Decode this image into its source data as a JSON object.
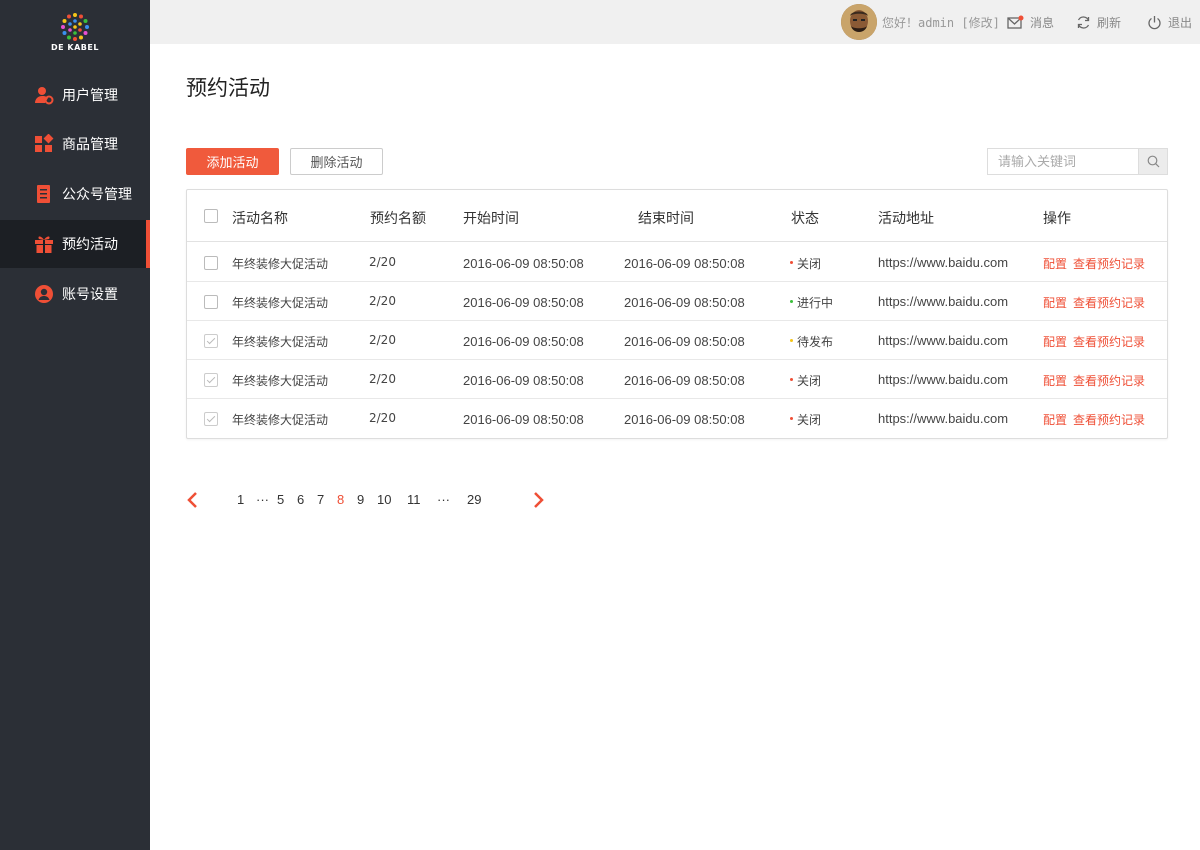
{
  "app": {
    "logo_text": "DE KABEL"
  },
  "sidebar": {
    "items": [
      {
        "label": "用户管理",
        "icon": "user-settings-icon",
        "active": false
      },
      {
        "label": "商品管理",
        "icon": "apps-icon",
        "active": false
      },
      {
        "label": "公众号管理",
        "icon": "document-icon",
        "active": false
      },
      {
        "label": "预约活动",
        "icon": "gift-icon",
        "active": true
      },
      {
        "label": "账号设置",
        "icon": "account-icon",
        "active": false
      }
    ]
  },
  "topbar": {
    "greeting": "您好！admin [修改]",
    "messages_label": "消息",
    "refresh_label": "刷新",
    "logout_label": "退出"
  },
  "page": {
    "title": "预约活动",
    "add_button": "添加活动",
    "delete_button": "删除活动",
    "search_placeholder": "请输入关键词"
  },
  "table": {
    "headers": [
      "活动名称",
      "预约名额",
      "开始时间",
      "结束时间",
      "状态",
      "活动地址",
      "操作"
    ],
    "rows": [
      {
        "checked": false,
        "name": "年终装修大促活动",
        "quota": "2/20",
        "start": "2016-06-09  08:50:08",
        "end": "2016-06-09  08:50:08",
        "status": "关闭",
        "status_color": "#ef4f36",
        "url": "https://www.baidu.com",
        "op1": "配置",
        "op2": "查看预约记录"
      },
      {
        "checked": false,
        "name": "年终装修大促活动",
        "quota": "2/20",
        "start": "2016-06-09  08:50:08",
        "end": "2016-06-09  08:50:08",
        "status": "进行中",
        "status_color": "#3bbf3b",
        "url": "https://www.baidu.com",
        "op1": "配置",
        "op2": "查看预约记录"
      },
      {
        "checked": true,
        "name": "年终装修大促活动",
        "quota": "2/20",
        "start": "2016-06-09  08:50:08",
        "end": "2016-06-09  08:50:08",
        "status": "待发布",
        "status_color": "#f5c518",
        "url": "https://www.baidu.com",
        "op1": "配置",
        "op2": "查看预约记录"
      },
      {
        "checked": true,
        "name": "年终装修大促活动",
        "quota": "2/20",
        "start": "2016-06-09  08:50:08",
        "end": "2016-06-09  08:50:08",
        "status": "关闭",
        "status_color": "#ef4f36",
        "url": "https://www.baidu.com",
        "op1": "配置",
        "op2": "查看预约记录"
      },
      {
        "checked": true,
        "name": "年终装修大促活动",
        "quota": "2/20",
        "start": "2016-06-09  08:50:08",
        "end": "2016-06-09  08:50:08",
        "status": "关闭",
        "status_color": "#ef4f36",
        "url": "https://www.baidu.com",
        "op1": "配置",
        "op2": "查看预约记录"
      }
    ]
  },
  "pagination": {
    "items": [
      "1",
      "···",
      "5",
      "6",
      "7",
      "8",
      "9",
      "10",
      "11",
      "···",
      "29"
    ],
    "current": "8"
  },
  "colors": {
    "accent": "#ef4f36",
    "sidebar_bg": "#2b2f36",
    "sidebar_active_bg": "#1c1f24",
    "topbar_bg": "#f0f0f0"
  }
}
